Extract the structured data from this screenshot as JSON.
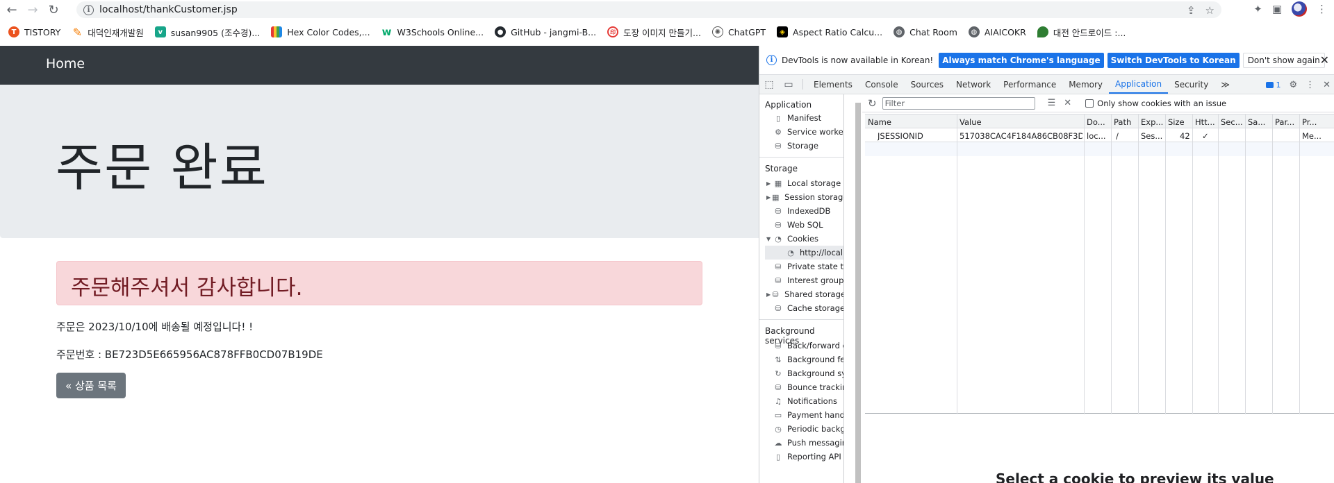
{
  "browser": {
    "url": "localhost/thankCustomer.jsp",
    "bookmarks": [
      {
        "label": "TISTORY",
        "icon": "tistory-icon"
      },
      {
        "label": "대덕인재개발원",
        "icon": "ddit-icon"
      },
      {
        "label": "susan9905 (조수경)...",
        "icon": "velog-icon"
      },
      {
        "label": "Hex Color Codes,...",
        "icon": "hex-color-icon"
      },
      {
        "label": "W3Schools Online...",
        "icon": "w3schools-icon"
      },
      {
        "label": "GitHub - jangmi-B...",
        "icon": "github-icon"
      },
      {
        "label": "도장 이미지 만들기...",
        "icon": "stamp-icon"
      },
      {
        "label": "ChatGPT",
        "icon": "chatgpt-icon"
      },
      {
        "label": "Aspect Ratio Calcu...",
        "icon": "aspect-ratio-icon"
      },
      {
        "label": "Chat Room",
        "icon": "globe-icon"
      },
      {
        "label": "AIAICOKR",
        "icon": "globe-icon"
      },
      {
        "label": "대전 안드로이드 :...",
        "icon": "android-icon"
      }
    ]
  },
  "page": {
    "nav_brand": "Home",
    "jumbotron_title": "주문 완료",
    "alert_text": "주문해주셔서 감사합니다.",
    "delivery_text": "주문은 2023/10/10에 배송될 예정입니다! !",
    "order_number_text": "주문번호 : BE723D5E665956AC878FFB0CD07B19DE",
    "back_button": "« 상품 목록"
  },
  "devtools": {
    "banner": {
      "message": "DevTools is now available in Korean!",
      "btn_match": "Always match Chrome's language",
      "btn_switch": "Switch DevTools to Korean",
      "btn_dismiss": "Don't show again"
    },
    "tabs": [
      "Elements",
      "Console",
      "Sources",
      "Network",
      "Performance",
      "Memory",
      "Application",
      "Security"
    ],
    "active_tab": "Application",
    "issues_count": "1",
    "sidebar": {
      "application_header": "Application",
      "application_items": [
        "Manifest",
        "Service workers",
        "Storage"
      ],
      "storage_header": "Storage",
      "storage_items": [
        "Local storage",
        "Session storage",
        "IndexedDB",
        "Web SQL",
        "Cookies",
        "http://localhost",
        "Private state tok",
        "Interest groups",
        "Shared storage",
        "Cache storage"
      ],
      "bg_header": "Background services",
      "bg_items": [
        "Back/forward ca",
        "Background fetc",
        "Background sync",
        "Bounce tracking",
        "Notifications",
        "Payment handle",
        "Periodic backgro",
        "Push messaging",
        "Reporting API"
      ]
    },
    "cookies": {
      "filter_placeholder": "Filter",
      "only_issues_label": "Only show cookies with an issue",
      "columns": [
        "Name",
        "Value",
        "Do...",
        "Path",
        "Exp...",
        "Size",
        "Htt...",
        "Sec...",
        "Sa...",
        "Par...",
        "Pr..."
      ],
      "rows": [
        [
          "JSESSIONID",
          "517038CAC4F184A86CB08F3D...",
          "loc...",
          "/",
          "Ses...",
          "42",
          "✓",
          "",
          "",
          "",
          "Me..."
        ]
      ],
      "placeholder_text": "Select a cookie to preview its value"
    }
  }
}
